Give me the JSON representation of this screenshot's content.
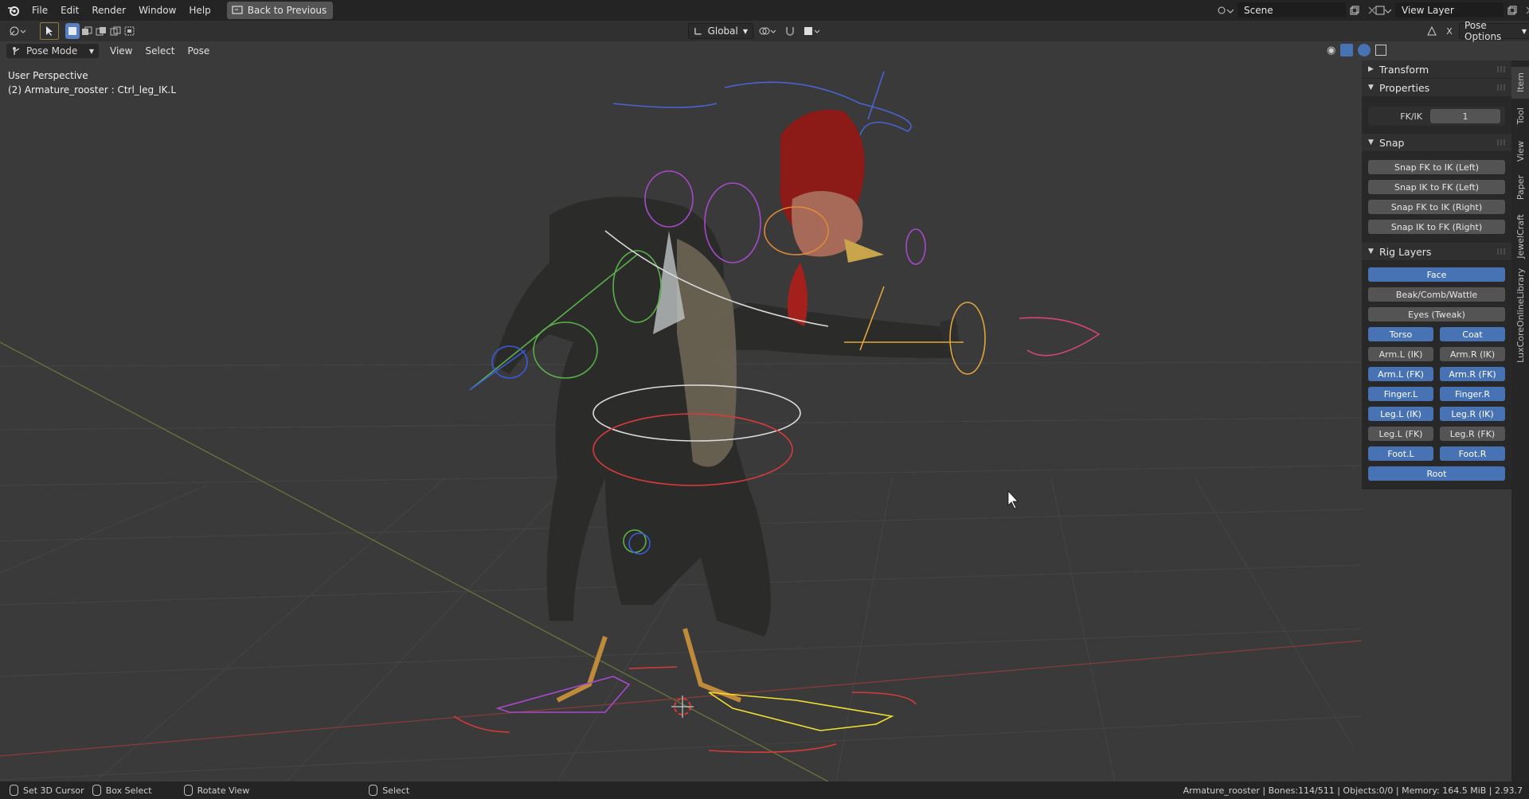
{
  "menubar": {
    "items": [
      "File",
      "Edit",
      "Render",
      "Window",
      "Help"
    ],
    "back_button": "Back to Previous",
    "scene": "Scene",
    "view_layer": "View Layer"
  },
  "header": {
    "transform_orientation": "Global",
    "pose_options": "Pose Options",
    "mode": "Pose Mode",
    "menus": [
      "View",
      "Select",
      "Pose"
    ]
  },
  "viewport": {
    "perspective": "User Perspective",
    "active_object": "(2) Armature_rooster : Ctrl_leg_IK.L"
  },
  "sidebar": {
    "transform_title": "Transform",
    "properties_title": "Properties",
    "fkik_label": "FK/IK",
    "fkik_value": "1",
    "snap_title": "Snap",
    "snap_buttons": [
      "Snap FK to IK (Left)",
      "Snap IK to FK (Left)",
      "Snap FK to IK (Right)",
      "Snap IK to FK (Right)"
    ],
    "rig_layers_title": "Rig Layers",
    "rig_layers": [
      {
        "label": "Face",
        "on": true
      },
      {
        "label": "Beak/Comb/Wattle",
        "on": false
      },
      {
        "label": "Eyes (Tweak)",
        "on": false
      },
      {
        "label": "Torso",
        "on": true
      },
      {
        "label": "Coat",
        "on": true
      },
      {
        "label": "Arm.L (IK)",
        "on": false
      },
      {
        "label": "Arm.R (IK)",
        "on": false
      },
      {
        "label": "Arm.L (FK)",
        "on": true
      },
      {
        "label": "Arm.R (FK)",
        "on": true
      },
      {
        "label": "Finger.L",
        "on": true
      },
      {
        "label": "Finger.R",
        "on": true
      },
      {
        "label": "Leg.L (IK)",
        "on": true
      },
      {
        "label": "Leg.R (IK)",
        "on": true
      },
      {
        "label": "Leg.L (FK)",
        "on": false
      },
      {
        "label": "Leg.R (FK)",
        "on": false
      },
      {
        "label": "Foot.L",
        "on": true
      },
      {
        "label": "Foot.R",
        "on": true
      },
      {
        "label": "Root",
        "on": true
      }
    ],
    "tabs": [
      "Item",
      "Tool",
      "View",
      "Paper",
      "JewelCraft",
      "LuxCoreOnlineLibrary"
    ]
  },
  "statusbar": {
    "set_cursor": "Set 3D Cursor",
    "box_select": "Box Select",
    "rotate_view": "Rotate View",
    "select": "Select",
    "stats": "Armature_rooster | Bones:114/511 | Objects:0/0 | Memory: 164.5 MiB | 2.93.7"
  },
  "colors": {
    "accent": "#4772b3",
    "background": "#3a3a3a",
    "panel": "#282828"
  }
}
